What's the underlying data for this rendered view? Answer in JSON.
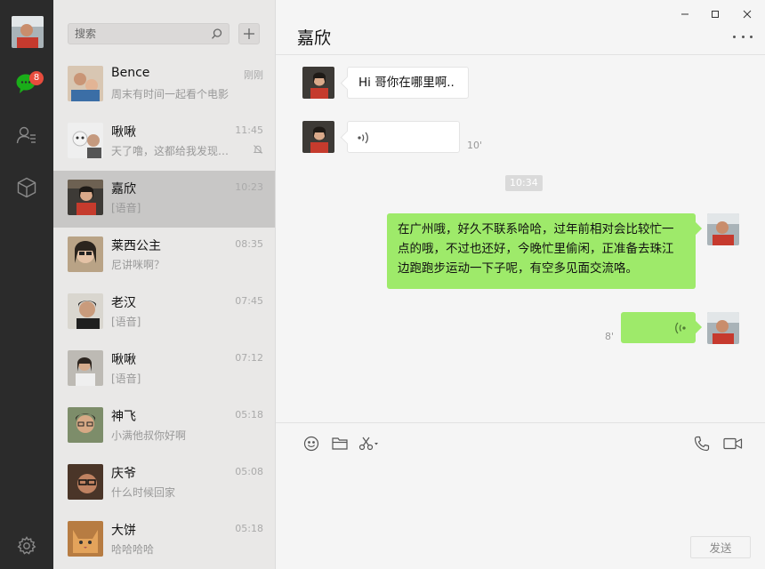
{
  "search": {
    "placeholder": "搜索"
  },
  "nav": {
    "unread_badge": "8"
  },
  "conversations": [
    {
      "name": "Bence",
      "preview": "周末有时间一起看个电影",
      "time": "刚刚",
      "muted": false
    },
    {
      "name": "啾啾",
      "preview": "天了噜，这都给我发现哈哈哈",
      "time": "11:45",
      "muted": true
    },
    {
      "name": "嘉欣",
      "preview": "[语音]",
      "time": "10:23",
      "muted": false
    },
    {
      "name": "莱西公主",
      "preview": "尼讲咪啊？",
      "time": "08:35",
      "muted": false
    },
    {
      "name": "老汉",
      "preview": "[语音]",
      "time": "07:45",
      "muted": false
    },
    {
      "name": "啾啾",
      "preview": "[语音]",
      "time": "07:12",
      "muted": false
    },
    {
      "name": "神飞",
      "preview": "小满他叔你好啊",
      "time": "05:18",
      "muted": false
    },
    {
      "name": "庆爷",
      "preview": "什么时候回家",
      "time": "05:08",
      "muted": false
    },
    {
      "name": "大饼",
      "preview": "哈哈哈哈",
      "time": "05:18",
      "muted": false
    }
  ],
  "chat": {
    "title": "嘉欣",
    "messages": [
      {
        "direction": "in",
        "type": "text",
        "text": "Hi 哥你在哪里啊.."
      },
      {
        "direction": "in",
        "type": "voice",
        "duration": "10'"
      },
      {
        "type": "timestamp",
        "text": "10:34"
      },
      {
        "direction": "out",
        "type": "text",
        "lines": [
          "在广州哦，好久不联系哈哈，过年前相对会比较忙一",
          "点的哦，不过也还好，今晚忙里偷闲，正准备去珠江",
          "边跑跑步运动一下子呢，有空多见面交流咯。"
        ]
      },
      {
        "direction": "out",
        "type": "voice",
        "duration": "8'"
      }
    ]
  },
  "composer": {
    "send_label": "发送"
  },
  "colors": {
    "rail": "#2b2b2b",
    "list_bg": "#e9e8e7",
    "active_row": "#c8c7c6",
    "out_bubble": "#9eea6a",
    "badge": "#e84c3d",
    "wechat_green": "#1aad19"
  }
}
